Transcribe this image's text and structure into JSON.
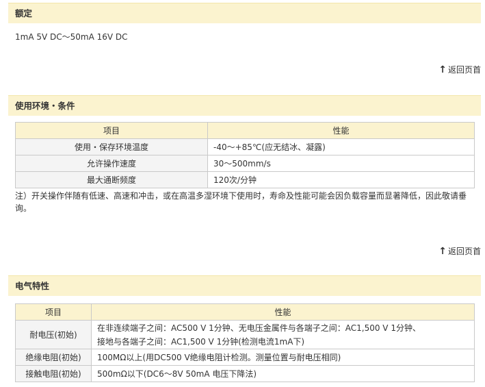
{
  "rated": {
    "header": "额定",
    "text": "1mA 5V DC～50mA 16V DC",
    "back_to_top": "返回页首"
  },
  "environment": {
    "header": "使用环境・条件",
    "columns": [
      "项目",
      "性能"
    ],
    "rows": [
      {
        "item": "使用・保存环境温度",
        "performance": "-40～+85℃(应无结冰、凝露)"
      },
      {
        "item": "允许操作速度",
        "performance": "30～500mm/s"
      },
      {
        "item": "最大通断频度",
        "performance": "120次/分钟"
      }
    ],
    "note": "注）开关操作伴随有低速、高速和冲击，或在高温多湿环境下使用时，寿命及性能可能会因负载容量而显著降低，因此敬请垂询。",
    "back_to_top": "返回页首"
  },
  "electrical": {
    "header": "电气特性",
    "columns": [
      "项目",
      "性能"
    ],
    "rows": [
      {
        "item": "耐电压(初始)",
        "performance_lines": [
          "在非连续端子之间：AC500 V 1分钟、无电压金属件与各端子之间：AC1,500 V 1分钟、",
          "接地与各端子之间：AC1,500 V 1分钟(检测电流1mA下)"
        ]
      },
      {
        "item": "绝缘电阻(初始)",
        "performance_lines": [
          "100MΩ以上(用DC500 V绝缘电阻计检测。测量位置与耐电压相同)"
        ]
      },
      {
        "item": "接触电阻(初始)",
        "performance_lines": [
          "500mΩ以下(DC6～8V 50mA 电压下降法)"
        ]
      }
    ]
  }
}
